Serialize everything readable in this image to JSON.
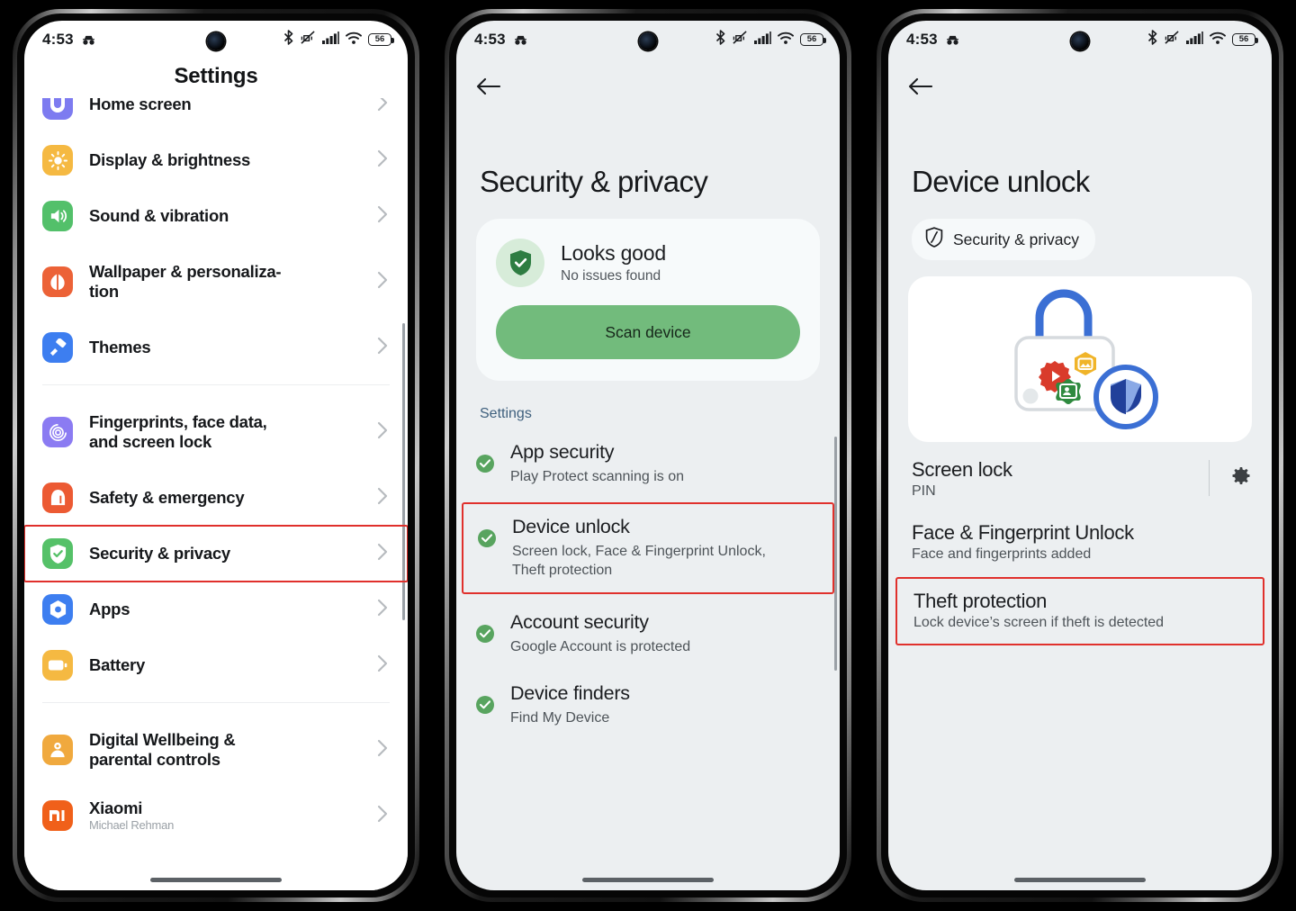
{
  "statusbar": {
    "time": "4:53",
    "battery_percent": "56",
    "icons": [
      "incognito-icon",
      "camera-punch-hole",
      "bluetooth-icon",
      "vibrate-off-icon",
      "signal-bars-icon",
      "wifi-icon",
      "battery-icon"
    ]
  },
  "colors": {
    "highlight_red": "#e0302c",
    "green_accent": "#58a45f",
    "scan_button": "#72bb7c",
    "link_blue": "#3e5f7d"
  },
  "phone1": {
    "title": "Settings",
    "items": [
      {
        "label": "Home screen",
        "icon": "home-screen-icon",
        "color": "#7d7bf0",
        "highlight": false
      },
      {
        "label": "Display & brightness",
        "icon": "brightness-icon",
        "color": "#f5b942",
        "highlight": false
      },
      {
        "label": "Sound & vibration",
        "icon": "speaker-icon",
        "color": "#53c06a",
        "highlight": false
      },
      {
        "label": "Wallpaper & personaliza-\ntion",
        "icon": "wallpaper-icon",
        "color": "#ec6237",
        "highlight": false
      },
      {
        "label": "Themes",
        "icon": "theme-brush-icon",
        "color": "#3d7ef0",
        "highlight": false
      },
      {
        "label": "Fingerprints, face data,\nand screen lock",
        "icon": "fingerprint-icon",
        "color": "#8b7bf2",
        "highlight": false
      },
      {
        "label": "Safety & emergency",
        "icon": "emergency-icon",
        "color": "#ec5a33",
        "highlight": false
      },
      {
        "label": "Security & privacy",
        "icon": "security-shield-icon",
        "color": "#55c168",
        "highlight": true
      },
      {
        "label": "Apps",
        "icon": "apps-icon",
        "color": "#3d7ef0",
        "highlight": false
      },
      {
        "label": "Battery",
        "icon": "battery-settings-icon",
        "color": "#f5b942",
        "highlight": false
      },
      {
        "label": "Digital Wellbeing &\nparental controls",
        "icon": "wellbeing-icon",
        "color": "#f0a93e",
        "highlight": false
      },
      {
        "label": "Xiaomi",
        "icon": "xiaomi-icon",
        "color": "#f0601a",
        "highlight": false,
        "sub": "Michael Rehman"
      }
    ]
  },
  "phone2": {
    "back": "back-arrow",
    "title": "Security & privacy",
    "status_card": {
      "heading": "Looks good",
      "subheading": "No issues found",
      "button": "Scan device"
    },
    "section_label": "Settings",
    "items": [
      {
        "title": "App security",
        "desc": "Play Protect scanning is on",
        "highlight": false
      },
      {
        "title": "Device unlock",
        "desc": "Screen lock, Face & Fingerprint Unlock, Theft protection",
        "highlight": true
      },
      {
        "title": "Account security",
        "desc": "Google Account is protected",
        "highlight": false
      },
      {
        "title": "Device finders",
        "desc": "Find My Device",
        "highlight": false
      }
    ]
  },
  "phone3": {
    "back": "back-arrow",
    "title": "Device unlock",
    "chip": "Security & privacy",
    "illustration": "lock-with-app-icons-illustration",
    "rows": [
      {
        "title": "Screen lock",
        "desc": "PIN",
        "highlight": false,
        "gear": true
      },
      {
        "title": "Face & Fingerprint Unlock",
        "desc": "Face and fingerprints added",
        "highlight": false,
        "gear": false
      },
      {
        "title": "Theft protection",
        "desc": "Lock device’s screen if theft is detected",
        "highlight": true,
        "gear": false
      }
    ]
  }
}
